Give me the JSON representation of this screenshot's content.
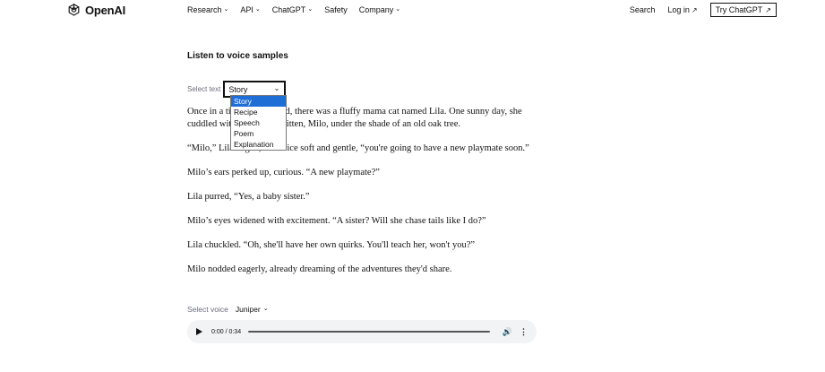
{
  "nav": {
    "logo_text": "OpenAI",
    "links": [
      {
        "label": "Research",
        "has_chevron": true
      },
      {
        "label": "API",
        "has_chevron": true
      },
      {
        "label": "ChatGPT",
        "has_chevron": true
      },
      {
        "label": "Safety",
        "has_chevron": false
      },
      {
        "label": "Company",
        "has_chevron": true
      }
    ],
    "search_label": "Search",
    "login_label": "Log in",
    "try_label": "Try ChatGPT"
  },
  "main": {
    "heading": "Listen to voice samples",
    "select_text": {
      "label": "Select text",
      "value": "Story",
      "options": [
        "Story",
        "Recipe",
        "Speech",
        "Poem",
        "Explanation"
      ],
      "highlighted": "Story"
    },
    "story_paragraphs": [
      "Once in a tiny, sunlit island, there was a fluffy mama cat named Lila. One sunny day, she cuddled with her playful kitten, Milo, under the shade of an old oak tree.",
      "“Milo,” Lila began, her voice soft and gentle, “you're going to have a new playmate soon.”",
      "Milo’s ears perked up, curious. “A new playmate?”",
      "Lila purred, “Yes, a baby sister.”",
      "Milo’s eyes widened with excitement. “A sister? Will she chase tails like I do?”",
      "Lila chuckled. “Oh, she'll have her own quirks. You'll teach her, won't you?”",
      "Milo nodded eagerly, already dreaming of the adventures they'd share."
    ],
    "select_voice": {
      "label": "Select voice",
      "value": "Juniper"
    },
    "player": {
      "time": "0:00 / 0:34",
      "progress": 0
    }
  },
  "colors": {
    "highlight": "#1e6ed6",
    "player_bg": "#f1f3f4",
    "muted_label": "#6e6e80"
  },
  "icons": [
    "openai-logo-icon",
    "chevron-down-icon",
    "external-arrow-icon",
    "play-icon",
    "volume-icon",
    "more-options-icon"
  ]
}
